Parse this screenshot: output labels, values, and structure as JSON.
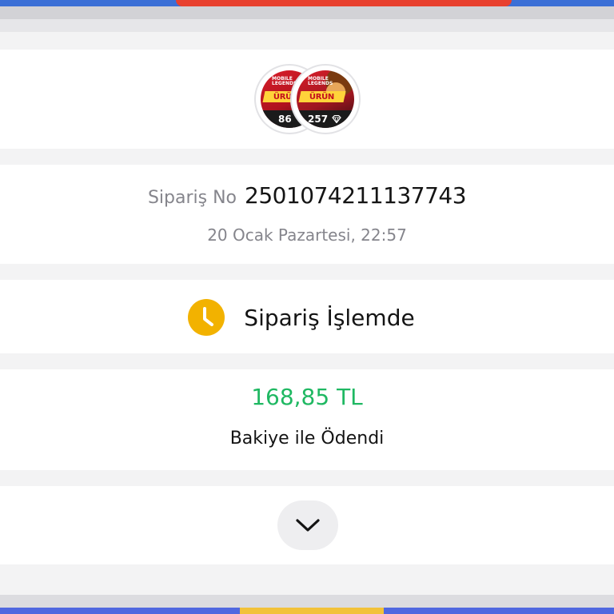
{
  "products": [
    {
      "brand": "MOBILE LEGENDS",
      "banner": "ÜRÜN",
      "quantity": "86",
      "icon": "diamond-icon"
    },
    {
      "brand": "MOBILE LEGENDS",
      "banner": "ÜRÜN",
      "quantity": "257",
      "icon": "diamond-icon"
    }
  ],
  "order": {
    "label": "Sipariş No",
    "number": "2501074211137743",
    "date": "20 Ocak Pazartesi, 22:57"
  },
  "status": {
    "icon": "clock-icon",
    "text": "Sipariş İşlemde",
    "color": "#f2b200"
  },
  "payment": {
    "amount": "168,85 TL",
    "amount_color": "#1fb862",
    "method": "Bakiye ile Ödendi"
  },
  "expand": {
    "icon": "chevron-down-icon"
  }
}
